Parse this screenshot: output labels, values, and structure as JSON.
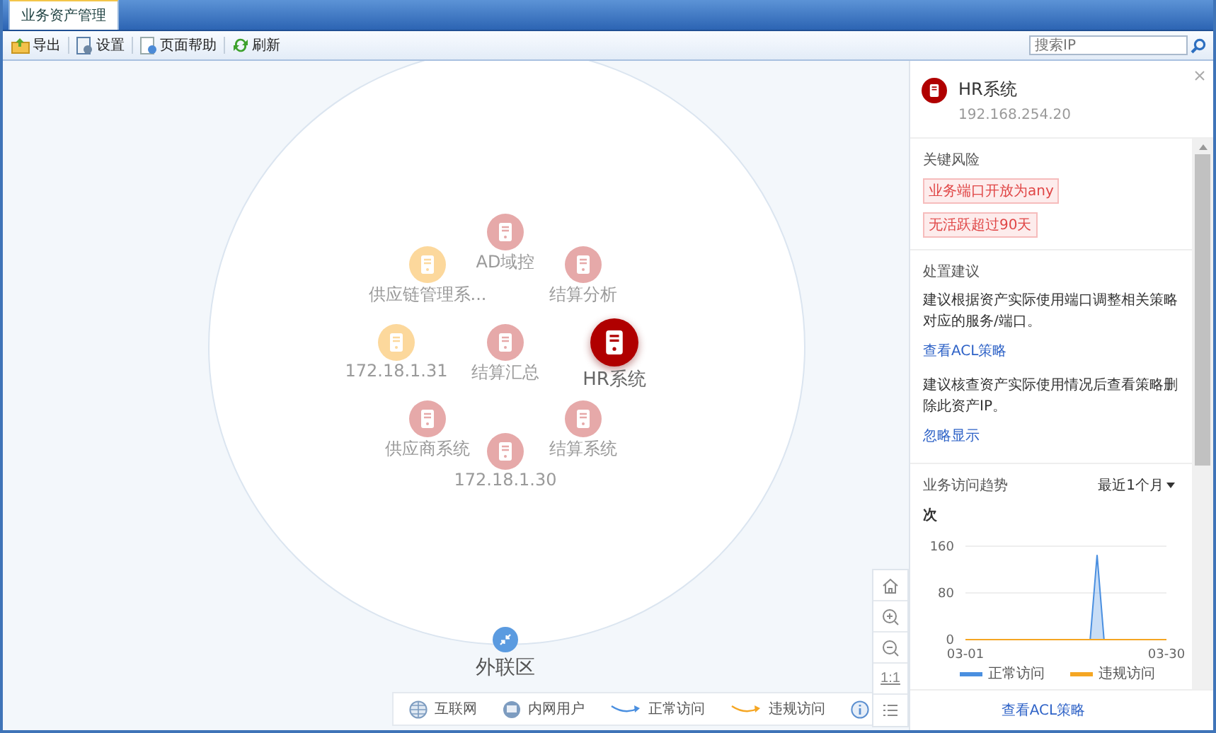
{
  "tabs": [
    {
      "label": "业务资产管理",
      "selected": true
    }
  ],
  "toolbar": [
    {
      "kind": "export",
      "label": "导出"
    },
    {
      "kind": "settings",
      "label": "设置"
    },
    {
      "kind": "help",
      "label": "页面帮助"
    },
    {
      "kind": "refresh",
      "label": "刷新"
    }
  ],
  "search": {
    "placeholder": "搜索IP"
  },
  "graph": {
    "nodes": [
      {
        "label": "AD域控",
        "color": "#e6a9a9",
        "selected": false
      },
      {
        "label": "供应链管理系...",
        "color": "#fcd89c",
        "selected": false
      },
      {
        "label": "结算分析",
        "color": "#e6a9a9",
        "selected": false
      },
      {
        "label": "172.18.1.31",
        "color": "#fcd89c",
        "selected": false
      },
      {
        "label": "结算汇总",
        "color": "#e6a9a9",
        "selected": false
      },
      {
        "label": "HR系统",
        "color": "#b00000",
        "selected": true
      },
      {
        "label": "供应商系统",
        "color": "#e6a9a9",
        "selected": false
      },
      {
        "label": "结算系统",
        "color": "#e6a9a9",
        "selected": false
      },
      {
        "label": "172.18.1.30",
        "color": "#e6a9a9",
        "selected": false
      }
    ],
    "zone": {
      "label": "外联区"
    }
  },
  "legend": [
    {
      "kind": "globe",
      "label": "互联网"
    },
    {
      "kind": "terminal",
      "label": "内网用户"
    },
    {
      "kind": "arrow",
      "label": "正常访问",
      "color": "#4a8fe0"
    },
    {
      "kind": "arrow",
      "label": "违规访问",
      "color": "#f5a623"
    }
  ],
  "zoom_controls": [
    {
      "kind": "home"
    },
    {
      "kind": "zoom-in"
    },
    {
      "kind": "zoom-out"
    },
    {
      "kind": "text",
      "label": "1:1"
    },
    {
      "kind": "list"
    }
  ],
  "detail": {
    "title": "HR系统",
    "ip": "192.168.254.20",
    "risks": {
      "title": "关键风险",
      "tags": [
        "业务端口开放为any",
        "无活跃超过90天"
      ]
    },
    "advice": {
      "title": "处置建议",
      "items": [
        {
          "text": "建议根据资产实际使用端口调整相关策略对应的服务/端口。",
          "link": "查看ACL策略"
        },
        {
          "text": "建议核查资产实际使用情况后查看策略删除此资产IP。",
          "link": "忽略显示"
        }
      ]
    },
    "trend": {
      "title": "业务访问趋势",
      "range": "最近1个月",
      "chart_data": {
        "type": "line",
        "ylabel": "次",
        "categories": [
          "03-01",
          null,
          null,
          null,
          null,
          null,
          null,
          null,
          null,
          null,
          null,
          null,
          null,
          null,
          null,
          null,
          null,
          null,
          null,
          null,
          null,
          null,
          null,
          null,
          null,
          null,
          null,
          null,
          null,
          "03-30"
        ],
        "series": [
          {
            "name": "正常访问",
            "color": "#4a8fe0",
            "values": [
              null,
              null,
              null,
              null,
              null,
              null,
              null,
              null,
              null,
              null,
              null,
              null,
              null,
              null,
              null,
              null,
              null,
              0,
              0,
              145,
              0,
              0,
              null,
              null,
              null,
              null,
              null,
              null,
              null,
              null
            ]
          },
          {
            "name": "违规访问",
            "color": "#f5a623",
            "values": [
              0,
              0,
              0,
              0,
              0,
              0,
              0,
              0,
              0,
              0,
              0,
              0,
              0,
              0,
              0,
              0,
              0,
              0,
              0,
              0,
              0,
              0,
              0,
              0,
              0,
              0,
              0,
              0,
              0,
              0
            ]
          }
        ],
        "ylim": [
          0,
          160
        ],
        "yticks": [
          0,
          80,
          160
        ]
      }
    },
    "footer_link": "查看ACL策略"
  }
}
